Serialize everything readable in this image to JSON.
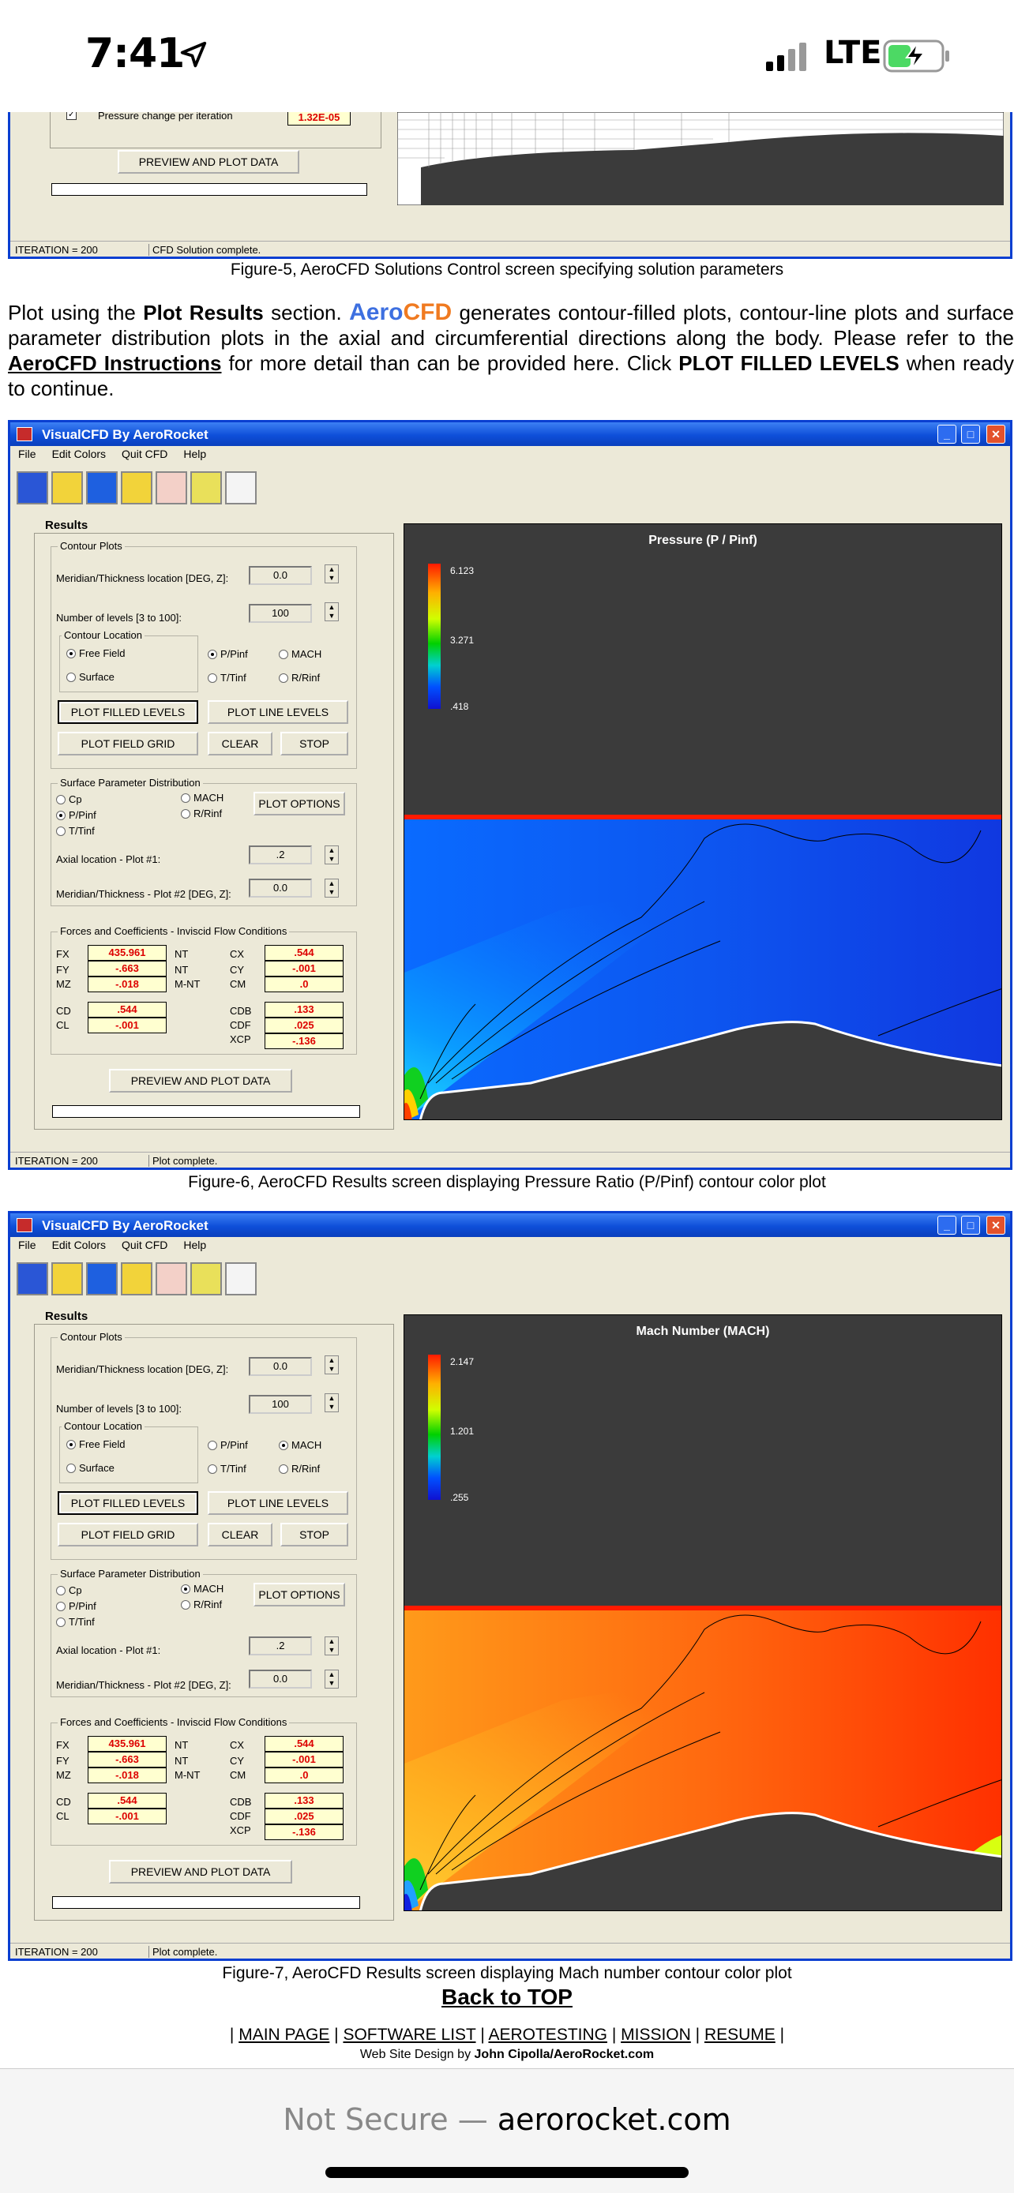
{
  "status_bar": {
    "time": "7:41",
    "carrier": "LTE"
  },
  "window": {
    "title": "VisualCFD By AeroRocket",
    "menu": [
      "File",
      "Edit Colors",
      "Quit CFD",
      "Help"
    ],
    "status_iteration": "ITERATION = 200"
  },
  "top_window": {
    "checkbox_label": "Pressure change per iteration",
    "checkbox_value": "1.32E-05",
    "preview_button": "PREVIEW AND PLOT DATA",
    "status_text": "CFD Solution complete."
  },
  "captions": {
    "fig5": "Figure-5, AeroCFD Solutions Control screen specifying solution parameters",
    "fig6": "Figure-6, AeroCFD Results screen displaying Pressure Ratio (P/Pinf) contour color plot",
    "fig7": "Figure-7, AeroCFD Results screen displaying Mach number contour color plot"
  },
  "paragraph": {
    "t1": "Plot using the ",
    "b1": "Plot Results",
    "t2": " section. ",
    "brand_a": "Aero",
    "brand_b": "CFD",
    "t3": " generates contour-filled plots, contour-line plots and surface parameter distribution plots in the axial and circumferential directions along the body. Please refer to the ",
    "link": "AeroCFD Instructions",
    "t4": " for more detail than can be provided here. Click ",
    "b2": "PLOT FILLED LEVELS",
    "t5": " when ready to continue."
  },
  "results": {
    "section_title": "Results",
    "contour_group": "Contour Plots",
    "meridian_label": "Meridian/Thickness location [DEG, Z]:",
    "meridian_value": "0.0",
    "levels_label": "Number of levels [3 to 100]:",
    "levels_value": "100",
    "location_group": "Contour Location",
    "free_field": "Free Field",
    "surface": "Surface",
    "ppinf": "P/Pinf",
    "mach": "MACH",
    "ttinf": "T/Tinf",
    "rrinf": "R/Rinf",
    "plot_filled": "PLOT FILLED LEVELS",
    "plot_line": "PLOT LINE LEVELS",
    "plot_grid": "PLOT FIELD GRID",
    "clear": "CLEAR",
    "stop": "STOP",
    "surface_group": "Surface Parameter Distribution",
    "cp": "Cp",
    "plot_options": "PLOT OPTIONS",
    "axial_label": "Axial location - Plot #1:",
    "axial_value": ".2",
    "meridian2_label": "Meridian/Thickness - Plot #2 [DEG, Z]:",
    "meridian2_value": "0.0",
    "forces_group": "Forces and Coefficients - Inviscid Flow Conditions",
    "fx": "FX",
    "fy": "FY",
    "mz": "MZ",
    "cd": "CD",
    "cl": "CL",
    "nt": "NT",
    "mnt": "M-NT",
    "cx": "CX",
    "cy": "CY",
    "cm": "CM",
    "cdb": "CDB",
    "cdf": "CDF",
    "xcp": "XCP",
    "fx_v": "435.961",
    "fy_v": "-.663",
    "mz_v": "-.018",
    "cd_v": ".544",
    "cl_v": "-.001",
    "cx_v": ".544",
    "cy_v": "-.001",
    "cm_v": ".0",
    "cdb_v": ".133",
    "cdf_v": ".025",
    "xcp_v": "-.136",
    "preview": "PREVIEW AND PLOT DATA",
    "status_text": "Plot complete."
  },
  "plot_pressure": {
    "title": "Pressure (P / Pinf)",
    "cmax": "6.123",
    "cmid": "3.271",
    "cmin": ".418"
  },
  "plot_mach": {
    "title": "Mach Number (MACH)",
    "cmax": "2.147",
    "cmid": "1.201",
    "cmin": ".255"
  },
  "footer": {
    "back_to_top": "Back to TOP",
    "links": [
      "MAIN PAGE",
      "SOFTWARE LIST",
      "AEROTESTING",
      "MISSION",
      "RESUME"
    ],
    "design_prefix": "Web Site Design by ",
    "design_name": "John Cipolla/AeroRocket.com"
  },
  "browser": {
    "not_secure": "Not Secure — ",
    "domain": "aerorocket.com"
  }
}
